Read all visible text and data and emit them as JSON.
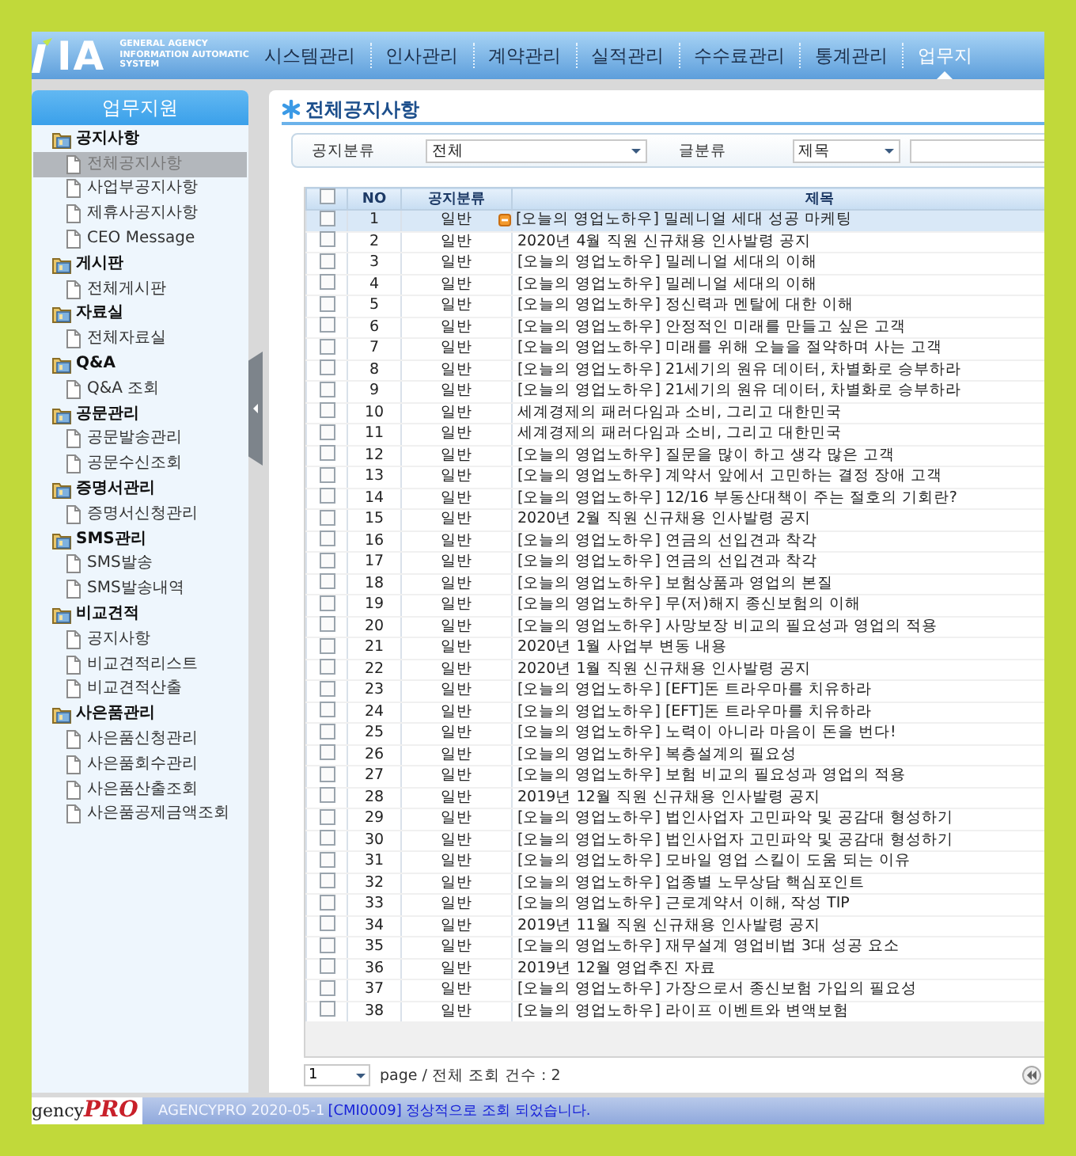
{
  "header": {
    "logo": "IA",
    "logo_subtitle": [
      "GENERAL AGENCY",
      "INFORMATION AUTOMATIC",
      "SYSTEM"
    ],
    "menu": [
      {
        "label": "시스템관리",
        "selected": false
      },
      {
        "label": "인사관리",
        "selected": false
      },
      {
        "label": "계약관리",
        "selected": false
      },
      {
        "label": "실적관리",
        "selected": false
      },
      {
        "label": "수수료관리",
        "selected": false
      },
      {
        "label": "통계관리",
        "selected": false
      },
      {
        "label": "업무지",
        "selected": true
      }
    ]
  },
  "sidebar": {
    "title": "업무지원",
    "groups": [
      {
        "label": "공지사항",
        "children": [
          {
            "label": "전체공지사항",
            "selected": true
          },
          {
            "label": "사업부공지사항",
            "selected": false
          },
          {
            "label": "제휴사공지사항",
            "selected": false
          },
          {
            "label": "CEO Message",
            "selected": false
          }
        ]
      },
      {
        "label": "게시판",
        "children": [
          {
            "label": "전체게시판",
            "selected": false
          }
        ]
      },
      {
        "label": "자료실",
        "children": [
          {
            "label": "전체자료실",
            "selected": false
          }
        ]
      },
      {
        "label": "Q&A",
        "children": [
          {
            "label": "Q&A 조회",
            "selected": false
          }
        ]
      },
      {
        "label": "공문관리",
        "children": [
          {
            "label": "공문발송관리",
            "selected": false
          },
          {
            "label": "공문수신조회",
            "selected": false
          }
        ]
      },
      {
        "label": "증명서관리",
        "children": [
          {
            "label": "증명서신청관리",
            "selected": false
          }
        ]
      },
      {
        "label": "SMS관리",
        "children": [
          {
            "label": "SMS발송",
            "selected": false
          },
          {
            "label": "SMS발송내역",
            "selected": false
          }
        ]
      },
      {
        "label": "비교견적",
        "children": [
          {
            "label": "공지사항",
            "selected": false
          },
          {
            "label": "비교견적리스트",
            "selected": false
          },
          {
            "label": "비교견적산출",
            "selected": false
          }
        ]
      },
      {
        "label": "사은품관리",
        "children": [
          {
            "label": "사은품신청관리",
            "selected": false
          },
          {
            "label": "사은품회수관리",
            "selected": false
          },
          {
            "label": "사은품산출조회",
            "selected": false
          },
          {
            "label": "사은품공제금액조회",
            "selected": false
          }
        ]
      }
    ]
  },
  "content": {
    "title": "전체공지사항",
    "filters": [
      {
        "label": "공지분류",
        "value": "전체"
      },
      {
        "label": "글분류",
        "value": "제목"
      }
    ],
    "table": {
      "columns": [
        "NO",
        "공지분류",
        "제목"
      ],
      "all_checked": false,
      "rows": [
        {
          "no": "1",
          "category": "일반",
          "title": "[오늘의 영업노하우] 밀레니얼 세대 성공 마케팅",
          "checked": false,
          "selected": true,
          "new": true
        },
        {
          "no": "2",
          "category": "일반",
          "title": "2020년 4월 직원 신규채용 인사발령 공지",
          "checked": false,
          "selected": false,
          "new": false
        },
        {
          "no": "3",
          "category": "일반",
          "title": "[오늘의 영업노하우] 밀레니얼 세대의 이해",
          "checked": false,
          "selected": false,
          "new": false
        },
        {
          "no": "4",
          "category": "일반",
          "title": "[오늘의 영업노하우] 밀레니얼 세대의 이해",
          "checked": false,
          "selected": false,
          "new": false
        },
        {
          "no": "5",
          "category": "일반",
          "title": "[오늘의 영업노하우] 정신력과 멘탈에 대한 이해",
          "checked": false,
          "selected": false,
          "new": false
        },
        {
          "no": "6",
          "category": "일반",
          "title": "[오늘의 영업노하우] 안정적인 미래를 만들고 싶은 고객",
          "checked": false,
          "selected": false,
          "new": false
        },
        {
          "no": "7",
          "category": "일반",
          "title": "[오늘의 영업노하우] 미래를 위해 오늘을 절약하며 사는 고객",
          "checked": false,
          "selected": false,
          "new": false
        },
        {
          "no": "8",
          "category": "일반",
          "title": "[오늘의 영업노하우] 21세기의 원유 데이터, 차별화로 승부하라",
          "checked": false,
          "selected": false,
          "new": false
        },
        {
          "no": "9",
          "category": "일반",
          "title": "[오늘의 영업노하우] 21세기의 원유 데이터, 차별화로 승부하라",
          "checked": false,
          "selected": false,
          "new": false
        },
        {
          "no": "10",
          "category": "일반",
          "title": "세계경제의 패러다임과 소비, 그리고 대한민국",
          "checked": false,
          "selected": false,
          "new": false
        },
        {
          "no": "11",
          "category": "일반",
          "title": "세계경제의 패러다임과 소비, 그리고 대한민국",
          "checked": false,
          "selected": false,
          "new": false
        },
        {
          "no": "12",
          "category": "일반",
          "title": "[오늘의 영업노하우] 질문을 많이 하고 생각 많은 고객",
          "checked": false,
          "selected": false,
          "new": false
        },
        {
          "no": "13",
          "category": "일반",
          "title": "[오늘의 영업노하우] 계약서 앞에서 고민하는 결정 장애 고객",
          "checked": false,
          "selected": false,
          "new": false
        },
        {
          "no": "14",
          "category": "일반",
          "title": "[오늘의 영업노하우] 12/16 부동산대책이 주는 절호의 기회란?",
          "checked": false,
          "selected": false,
          "new": false
        },
        {
          "no": "15",
          "category": "일반",
          "title": "2020년 2월 직원 신규채용 인사발령 공지",
          "checked": false,
          "selected": false,
          "new": false
        },
        {
          "no": "16",
          "category": "일반",
          "title": "[오늘의 영업노하우] 연금의 선입견과 착각",
          "checked": false,
          "selected": false,
          "new": false
        },
        {
          "no": "17",
          "category": "일반",
          "title": "[오늘의 영업노하우] 연금의 선입견과 착각",
          "checked": false,
          "selected": false,
          "new": false
        },
        {
          "no": "18",
          "category": "일반",
          "title": "[오늘의 영업노하우] 보험상품과 영업의 본질",
          "checked": false,
          "selected": false,
          "new": false
        },
        {
          "no": "19",
          "category": "일반",
          "title": "[오늘의 영업노하우] 무(저)해지 종신보험의 이해",
          "checked": false,
          "selected": false,
          "new": false
        },
        {
          "no": "20",
          "category": "일반",
          "title": "[오늘의 영업노하우] 사망보장 비교의 필요성과 영업의 적용",
          "checked": false,
          "selected": false,
          "new": false
        },
        {
          "no": "21",
          "category": "일반",
          "title": "2020년 1월 사업부 변동 내용",
          "checked": false,
          "selected": false,
          "new": false
        },
        {
          "no": "22",
          "category": "일반",
          "title": "2020년 1월 직원 신규채용 인사발령 공지",
          "checked": false,
          "selected": false,
          "new": false
        },
        {
          "no": "23",
          "category": "일반",
          "title": "[오늘의 영업노하우] [EFT]돈 트라우마를 치유하라",
          "checked": false,
          "selected": false,
          "new": false
        },
        {
          "no": "24",
          "category": "일반",
          "title": "[오늘의 영업노하우] [EFT]돈 트라우마를 치유하라",
          "checked": false,
          "selected": false,
          "new": false
        },
        {
          "no": "25",
          "category": "일반",
          "title": "[오늘의 영업노하우] 노력이 아니라 마음이 돈을 번다!",
          "checked": false,
          "selected": false,
          "new": false
        },
        {
          "no": "26",
          "category": "일반",
          "title": "[오늘의 영업노하우] 복층설계의 필요성",
          "checked": false,
          "selected": false,
          "new": false
        },
        {
          "no": "27",
          "category": "일반",
          "title": "[오늘의 영업노하우] 보험 비교의 필요성과 영업의 적용",
          "checked": false,
          "selected": false,
          "new": false
        },
        {
          "no": "28",
          "category": "일반",
          "title": "2019년 12월 직원 신규채용 인사발령 공지",
          "checked": false,
          "selected": false,
          "new": false
        },
        {
          "no": "29",
          "category": "일반",
          "title": "[오늘의 영업노하우] 법인사업자 고민파악 및 공감대 형성하기",
          "checked": false,
          "selected": false,
          "new": false
        },
        {
          "no": "30",
          "category": "일반",
          "title": "[오늘의 영업노하우] 법인사업자 고민파악 및 공감대 형성하기",
          "checked": false,
          "selected": false,
          "new": false
        },
        {
          "no": "31",
          "category": "일반",
          "title": "[오늘의 영업노하우] 모바일 영업 스킬이 도움 되는 이유",
          "checked": false,
          "selected": false,
          "new": false
        },
        {
          "no": "32",
          "category": "일반",
          "title": "[오늘의 영업노하우] 업종별 노무상담 핵심포인트",
          "checked": false,
          "selected": false,
          "new": false
        },
        {
          "no": "33",
          "category": "일반",
          "title": "[오늘의 영업노하우] 근로계약서 이해, 작성 TIP",
          "checked": false,
          "selected": false,
          "new": false
        },
        {
          "no": "34",
          "category": "일반",
          "title": "2019년 11월 직원 신규채용 인사발령 공지",
          "checked": false,
          "selected": false,
          "new": false
        },
        {
          "no": "35",
          "category": "일반",
          "title": "[오늘의 영업노하우] 재무설계 영업비법 3대 성공 요소",
          "checked": false,
          "selected": false,
          "new": false
        },
        {
          "no": "36",
          "category": "일반",
          "title": "2019년 12월 영업추진 자료",
          "checked": false,
          "selected": false,
          "new": false
        },
        {
          "no": "37",
          "category": "일반",
          "title": "[오늘의 영업노하우] 가장으로서 종신보험 가입의 필요성",
          "checked": false,
          "selected": false,
          "new": false
        },
        {
          "no": "38",
          "category": "일반",
          "title": "[오늘의 영업노하우] 라이프 이벤트와 변액보험",
          "checked": false,
          "selected": false,
          "new": false
        }
      ]
    },
    "pager": {
      "page": "1",
      "summary": "page / 전체 조회 건수 : 2"
    }
  },
  "status_bar": {
    "logo_text": "gency",
    "logo_accent": "PRO",
    "app": "AGENCYPRO 2020-05-1",
    "message": "[CMI0009] 정상적으로 조회 되었습니다."
  }
}
